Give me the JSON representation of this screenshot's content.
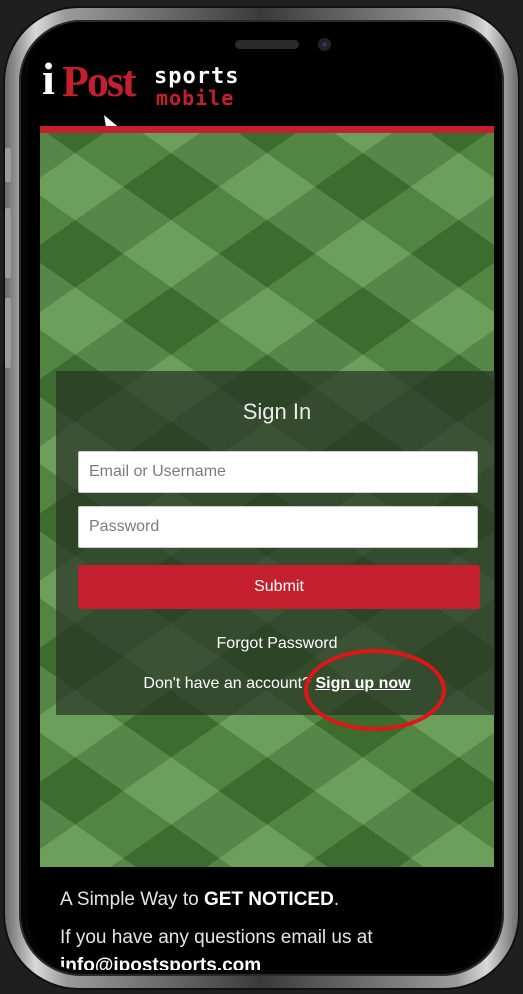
{
  "logo": {
    "i": "i",
    "post": "Post",
    "sports": "sports",
    "mobile": "mobile"
  },
  "signin": {
    "title": "Sign In",
    "email_placeholder": "Email or Username",
    "password_placeholder": "Password",
    "submit_label": "Submit",
    "forgot_label": "Forgot Password",
    "no_account_text": "Don't have an account?",
    "signup_label": "Sign up now"
  },
  "footer": {
    "tagline_prefix": "A Simple Way to",
    "tagline_emphasis": "GET NOTICED",
    "tagline_suffix": ".",
    "question": "If you have any questions email us at",
    "email": "info@ipostsports.com"
  },
  "colors": {
    "brand_red": "#c41f2e",
    "annotation_red": "#e01515",
    "turf_green": "#4d8a3a"
  }
}
